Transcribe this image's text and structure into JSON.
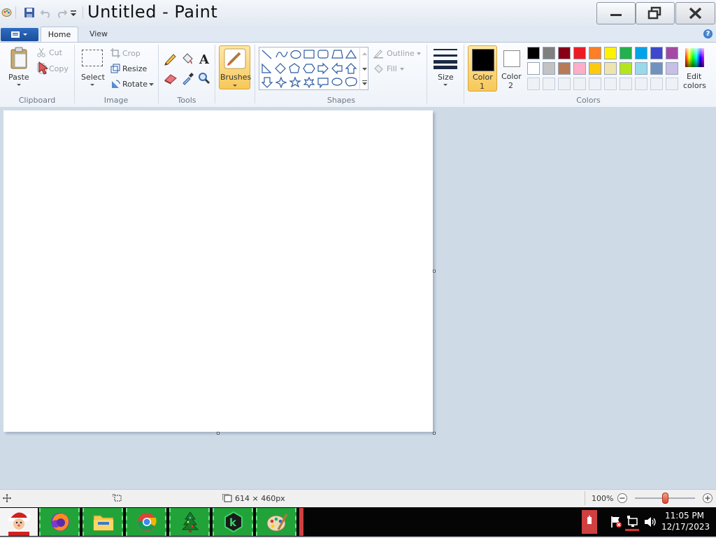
{
  "window": {
    "title": "Untitled - Paint"
  },
  "tabs": {
    "home": "Home",
    "view": "View"
  },
  "clipboard": {
    "paste": "Paste",
    "cut": "Cut",
    "copy": "Copy",
    "group": "Clipboard"
  },
  "image": {
    "select": "Select",
    "crop": "Crop",
    "resize": "Resize",
    "rotate": "Rotate",
    "group": "Image"
  },
  "tools": {
    "group": "Tools"
  },
  "brushes": {
    "label": "Brushes"
  },
  "shapes": {
    "outline": "Outline",
    "fill": "Fill",
    "group": "Shapes"
  },
  "size": {
    "label": "Size"
  },
  "colors": {
    "color1": "Color",
    "color1_num": "1",
    "color2": "Color",
    "color2_num": "2",
    "edit1": "Edit",
    "edit2": "colors",
    "group": "Colors",
    "color1_value": "#000000",
    "color2_value": "#ffffff",
    "palette_row1": [
      "#000000",
      "#7f7f7f",
      "#880015",
      "#ed1c24",
      "#ff7f27",
      "#fff200",
      "#22b14c",
      "#00a2e8",
      "#3f48cc",
      "#a349a4"
    ],
    "palette_row2": [
      "#ffffff",
      "#c3c3c3",
      "#b97a57",
      "#ffaec9",
      "#ffc90e",
      "#efe4b0",
      "#b5e61d",
      "#99d9ea",
      "#7092be",
      "#c8bfe7"
    ]
  },
  "status": {
    "canvas_size": "614 × 460px",
    "zoom": "100%",
    "zoom_level": 0.5
  },
  "taskbar": {
    "time": "11:05 PM",
    "date": "12/17/2023"
  },
  "icons": {
    "save": "save-icon",
    "undo": "undo-icon",
    "redo": "redo-icon",
    "pencil": "pencil-icon",
    "fill": "fill-bucket-icon",
    "text": "text-icon",
    "eraser": "eraser-icon",
    "picker": "color-picker-icon",
    "magnifier": "magnifier-icon"
  }
}
